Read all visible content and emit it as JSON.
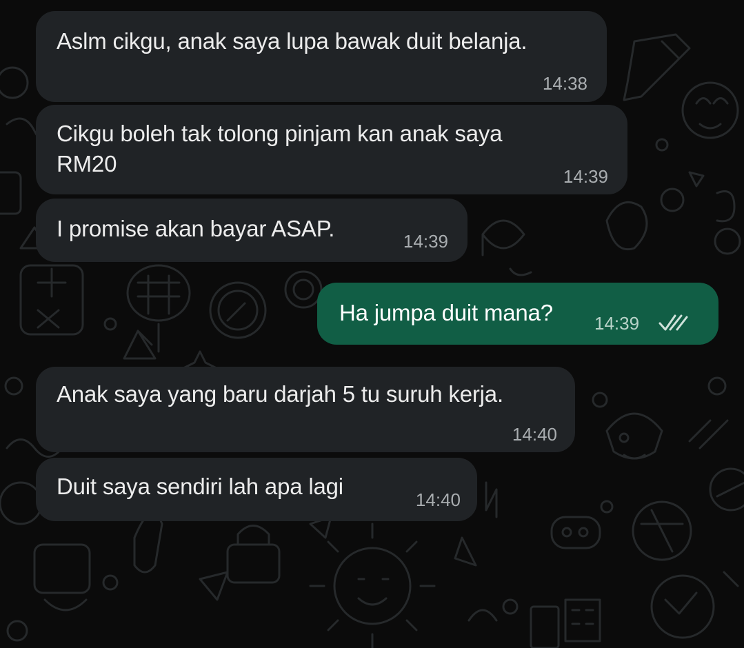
{
  "messages": [
    {
      "direction": "in",
      "text": "Aslm cikgu, anak saya lupa bawak duit belanja.",
      "time": "14:38"
    },
    {
      "direction": "in",
      "text": "Cikgu boleh tak tolong pinjam kan anak saya\nRM20",
      "time": "14:39"
    },
    {
      "direction": "in",
      "text": "I promise akan bayar ASAP.",
      "time": "14:39"
    },
    {
      "direction": "out",
      "text": "Ha jumpa duit mana?",
      "time": "14:39",
      "status_icon": "double-check-icon"
    },
    {
      "direction": "in",
      "text": "Anak saya yang baru darjah 5 tu suruh kerja.",
      "time": "14:40"
    },
    {
      "direction": "in",
      "text": "Duit saya sendiri lah apa lagi",
      "time": "14:40"
    }
  ],
  "colors": {
    "background": "#0b0b0b",
    "incoming_bubble": "#202326",
    "outgoing_bubble": "#115e45",
    "text": "#ececec",
    "timestamp": "#a9adb0"
  }
}
